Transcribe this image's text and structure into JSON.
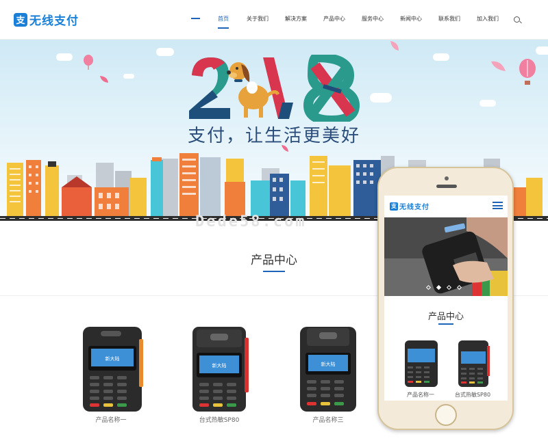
{
  "header": {
    "logo_icon": "支",
    "logo_text": "无线支付",
    "nav": [
      "首页",
      "关于我们",
      "解决方案",
      "产品中心",
      "服务中心",
      "新闻中心",
      "联系我们",
      "加入我们"
    ],
    "active_nav": "首页",
    "search_icon": "search-icon"
  },
  "banner": {
    "year_text": "2018",
    "slogan": "支付，让生活更美好"
  },
  "watermark": "Dede58.com",
  "products_section": {
    "title": "产品中心",
    "items": [
      {
        "name": "产品名称一",
        "screen_logo": "新大陆"
      },
      {
        "name": "台式热敏SP80",
        "screen_logo": "新大陆"
      },
      {
        "name": "产品名称三",
        "screen_logo": "新大陆"
      }
    ]
  },
  "mobile": {
    "logo_icon": "支",
    "logo_text": "无线支付",
    "menu_icon": "hamburger-icon",
    "section_title": "产品中心",
    "items": [
      {
        "name": "产品名称一"
      },
      {
        "name": "台式热敏SP80"
      }
    ]
  },
  "colors": {
    "brand": "#1a7fd6",
    "accent": "#1d64b8"
  }
}
